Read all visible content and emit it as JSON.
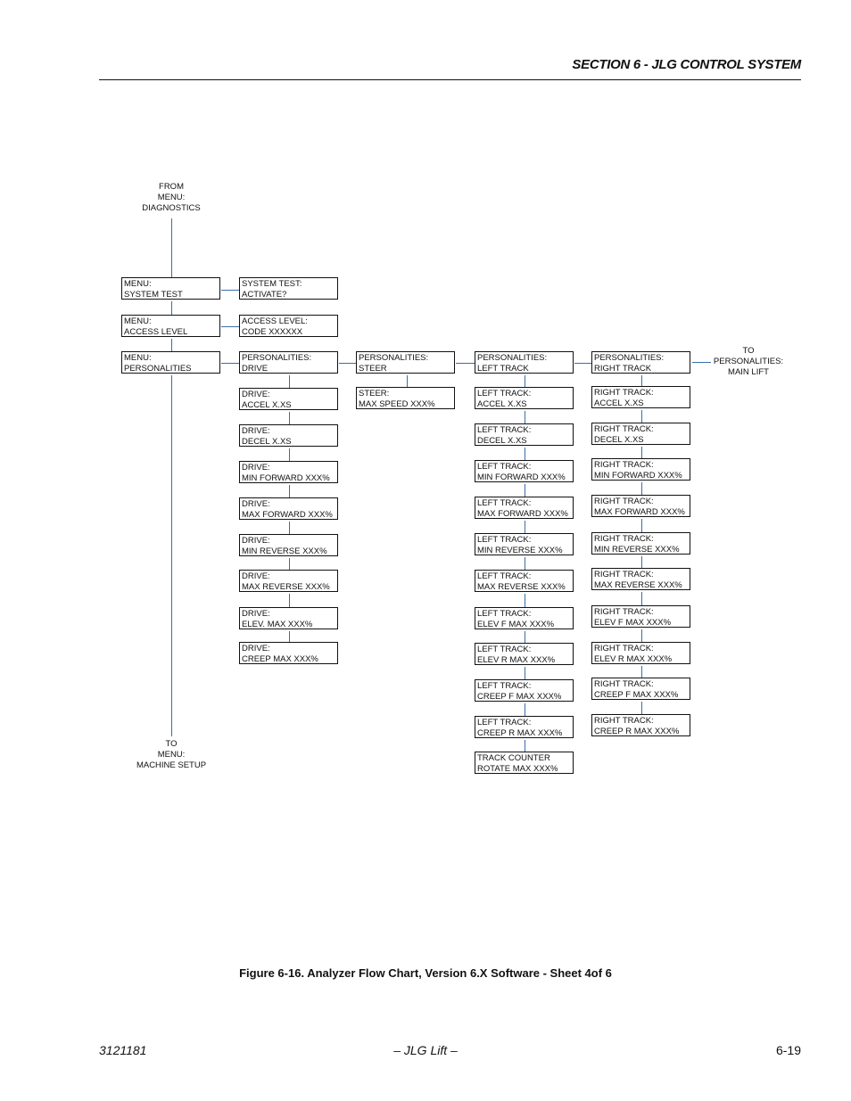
{
  "header": {
    "section_title": "SECTION 6 - JLG CONTROL SYSTEM"
  },
  "flowchart": {
    "from_label": [
      "FROM",
      "MENU:",
      "DIAGNOSTICS"
    ],
    "to_bottom_label": [
      "TO",
      "MENU:",
      "MACHINE SETUP"
    ],
    "to_right_label": [
      "TO",
      "PERSONALITIES:",
      "MAIN LIFT"
    ],
    "menu_column": [
      [
        "MENU:",
        "SYSTEM TEST"
      ],
      [
        "MENU:",
        "ACCESS LEVEL"
      ],
      [
        "MENU:",
        "PERSONALITIES"
      ]
    ],
    "system_test": [
      "SYSTEM TEST:",
      "ACTIVATE?"
    ],
    "access_level": [
      "ACCESS LEVEL:",
      "CODE XXXXXX"
    ],
    "drive_column": [
      [
        "PERSONALITIES:",
        "DRIVE"
      ],
      [
        "DRIVE:",
        "ACCEL X.XS"
      ],
      [
        "DRIVE:",
        "DECEL X.XS"
      ],
      [
        "DRIVE:",
        "MIN FORWARD XXX%"
      ],
      [
        "DRIVE:",
        "MAX FORWARD XXX%"
      ],
      [
        "DRIVE:",
        "MIN REVERSE XXX%"
      ],
      [
        "DRIVE:",
        "MAX REVERSE XXX%"
      ],
      [
        "DRIVE:",
        "ELEV. MAX XXX%"
      ],
      [
        "DRIVE:",
        "CREEP MAX XXX%"
      ]
    ],
    "steer_column": [
      [
        "PERSONALITIES:",
        "STEER"
      ],
      [
        "STEER:",
        "MAX SPEED XXX%"
      ]
    ],
    "left_track_column": [
      [
        "PERSONALITIES:",
        "LEFT TRACK"
      ],
      [
        "LEFT TRACK:",
        "ACCEL X.XS"
      ],
      [
        "LEFT TRACK:",
        "DECEL X.XS"
      ],
      [
        "LEFT TRACK:",
        "MIN FORWARD XXX%"
      ],
      [
        "LEFT TRACK:",
        "MAX FORWARD XXX%"
      ],
      [
        "LEFT TRACK:",
        "MIN REVERSE XXX%"
      ],
      [
        "LEFT TRACK:",
        "MAX REVERSE XXX%"
      ],
      [
        "LEFT TRACK:",
        "ELEV F MAX XXX%"
      ],
      [
        "LEFT TRACK:",
        "ELEV R MAX XXX%"
      ],
      [
        "LEFT TRACK:",
        "CREEP F MAX XXX%"
      ],
      [
        "LEFT TRACK:",
        "CREEP R MAX XXX%"
      ],
      [
        "TRACK COUNTER",
        "ROTATE MAX XXX%"
      ]
    ],
    "right_track_column": [
      [
        "PERSONALITIES:",
        "RIGHT TRACK"
      ],
      [
        "RIGHT TRACK:",
        "ACCEL X.XS"
      ],
      [
        "RIGHT TRACK:",
        "DECEL X.XS"
      ],
      [
        "RIGHT TRACK:",
        "MIN FORWARD XXX%"
      ],
      [
        "RIGHT TRACK:",
        "MAX FORWARD XXX%"
      ],
      [
        "RIGHT TRACK:",
        "MIN REVERSE XXX%"
      ],
      [
        "RIGHT TRACK:",
        "MAX REVERSE XXX%"
      ],
      [
        "RIGHT TRACK:",
        "ELEV F MAX XXX%"
      ],
      [
        "RIGHT TRACK:",
        "ELEV R MAX XXX%"
      ],
      [
        "RIGHT TRACK:",
        "CREEP F MAX XXX%"
      ],
      [
        "RIGHT TRACK:",
        "CREEP R MAX XXX%"
      ]
    ]
  },
  "caption": "Figure 6-16.  Analyzer Flow Chart, Version 6.X Software - Sheet 4of 6",
  "footer": {
    "doc_number": "3121181",
    "center": "– JLG Lift –",
    "page": "6-19"
  }
}
